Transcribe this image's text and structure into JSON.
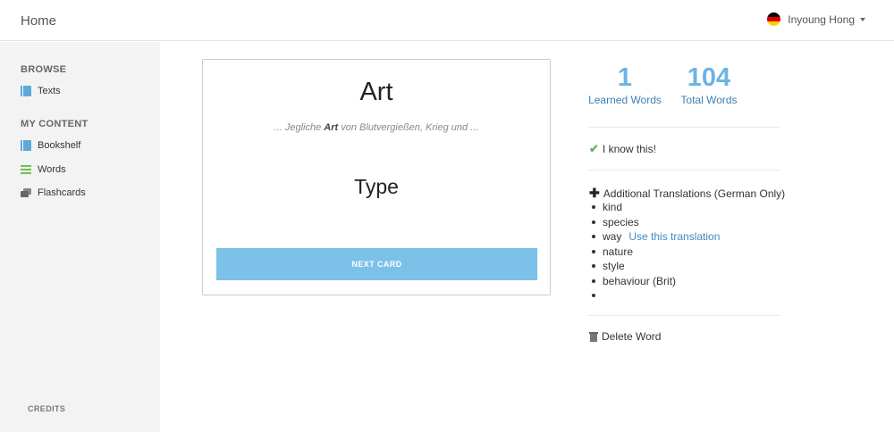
{
  "header": {
    "brand": "Home",
    "user_name": "Inyoung Hong",
    "language_icon": "germany-flag-icon",
    "flag_colors": [
      "#000000",
      "#dd0000",
      "#ffce00"
    ]
  },
  "sidebar": {
    "browse_heading": "BROWSE",
    "browse_items": [
      {
        "label": "Texts",
        "icon": "book-icon"
      }
    ],
    "my_content_heading": "MY CONTENT",
    "content_items": [
      {
        "label": "Bookshelf",
        "icon": "book-icon"
      },
      {
        "label": "Words",
        "icon": "list-icon"
      },
      {
        "label": "Flashcards",
        "icon": "cards-icon"
      }
    ],
    "credits": "CREDITS"
  },
  "card": {
    "word": "Art",
    "context_prefix": "... Jegliche ",
    "context_highlight": "Art",
    "context_suffix": " von Blutvergießen, Krieg und ...",
    "translation": "Type",
    "next_button": "NEXT CARD"
  },
  "stats": {
    "learned_count": "1",
    "learned_label": "Learned Words",
    "total_count": "104",
    "total_label": "Total Words"
  },
  "actions": {
    "know_label": "I know this!",
    "additional_label": "Additional Translations (German Only)",
    "translations": [
      "kind",
      "species",
      "way",
      "nature",
      "style",
      "behaviour (Brit)",
      ""
    ],
    "use_translation_label": "Use this translation",
    "delete_label": "Delete Word"
  },
  "colors": {
    "accent": "#7bc1e8",
    "stat_number": "#6cb4e4",
    "link": "#3f7fb5",
    "check": "#5cb85c"
  }
}
